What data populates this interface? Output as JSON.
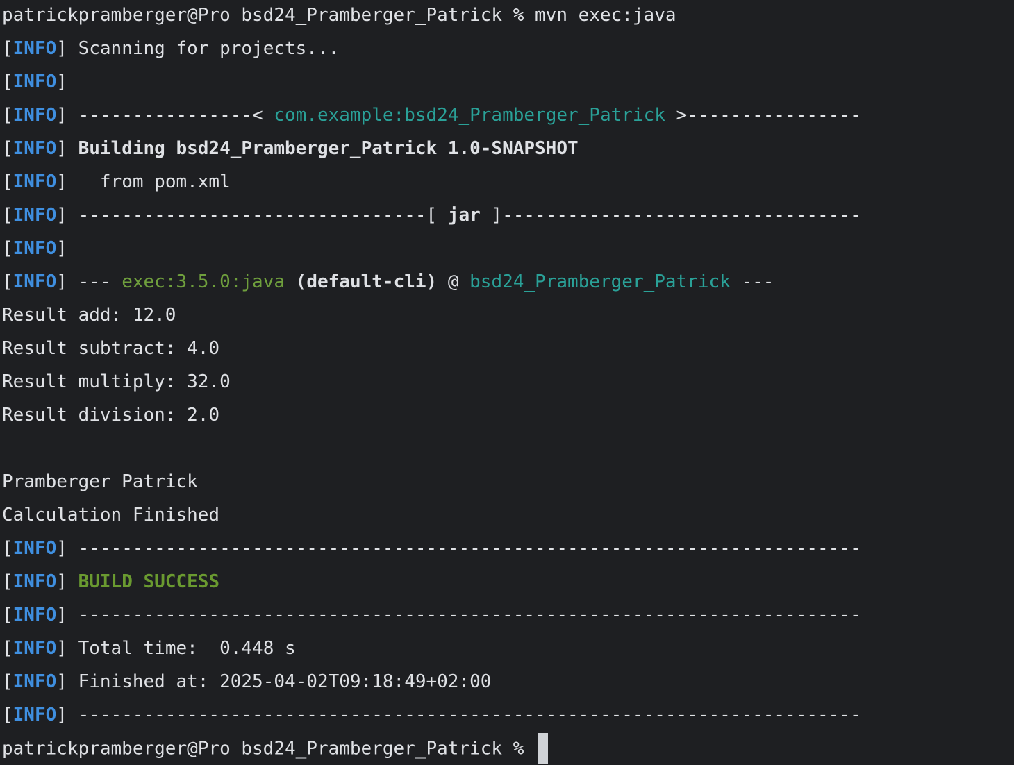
{
  "terminal": {
    "prompt": "patrickpramberger@Pro bsd24_Pramberger_Patrick %",
    "command": "mvn exec:java",
    "info_open": "[",
    "info_word": "INFO",
    "info_close": "]",
    "lines": {
      "scanning": " Scanning for projects...",
      "sep1_left": " ----------------< ",
      "artifact_id": "com.example:bsd24_Pramberger_Patrick",
      "sep1_right": " >----------------",
      "building": " Building bsd24_Pramberger_Patrick 1.0-SNAPSHOT",
      "from_pom": "   from pom.xml",
      "sep2_left": " --------------------------------[ ",
      "packaging": "jar",
      "sep2_right": " ]---------------------------------",
      "plugin_prefix": " --- ",
      "plugin": "exec:3.5.0:java",
      "execution": " (default-cli)",
      "at": " @ ",
      "project": "bsd24_Pramberger_Patrick",
      "plugin_suffix": " ---",
      "result_add": "Result add: 12.0",
      "result_subtract": "Result subtract: 4.0",
      "result_multiply": "Result multiply: 32.0",
      "result_division": "Result division: 2.0",
      "author": "Pramberger Patrick",
      "calc_finished": "Calculation Finished",
      "separator_full": " ------------------------------------------------------------------------",
      "build_status": "BUILD SUCCESS",
      "total_time": " Total time:  0.448 s",
      "finished_at": " Finished at: 2025-04-02T09:18:49+02:00"
    },
    "final_prompt": "patrickpramberger@Pro bsd24_Pramberger_Patrick %"
  }
}
